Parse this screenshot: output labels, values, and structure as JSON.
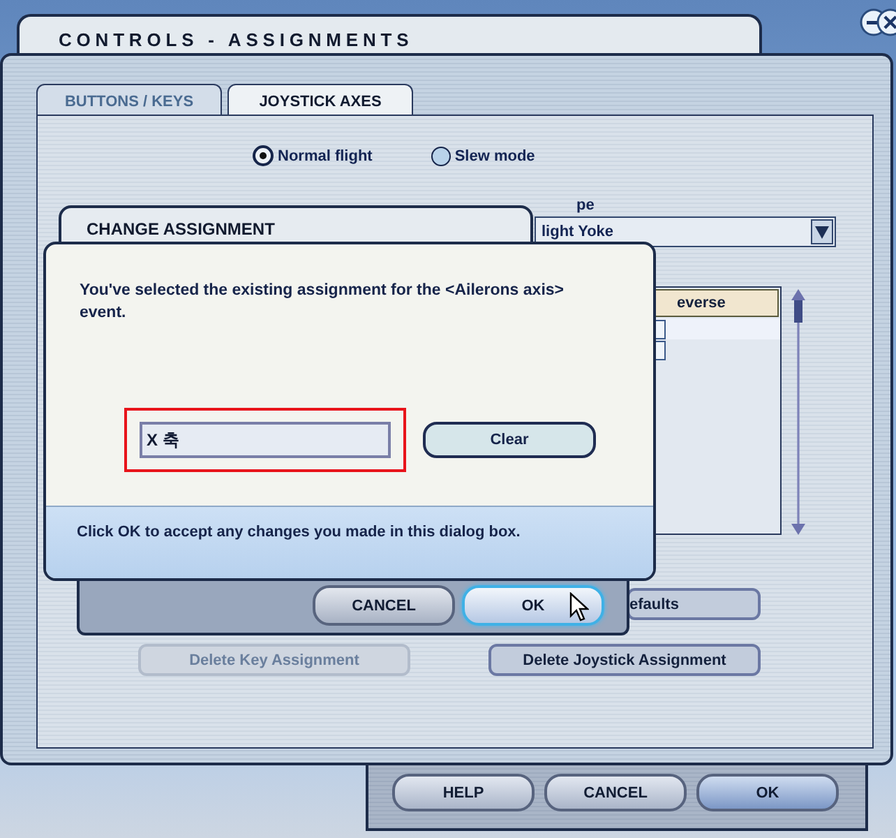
{
  "window": {
    "title": "CONTROLS - ASSIGNMENTS"
  },
  "tabs": [
    {
      "label": "BUTTONS / KEYS",
      "selected": false
    },
    {
      "label": "JOYSTICK AXES",
      "selected": true
    }
  ],
  "mode_options": [
    {
      "label": "Normal flight",
      "selected": true
    },
    {
      "label": "Slew mode",
      "selected": false
    }
  ],
  "joystick_type": {
    "label": "pe",
    "value": "light Yoke"
  },
  "assignment_list": {
    "column_header": "everse"
  },
  "buttons": [
    {
      "label": "efaults",
      "disabled": false
    },
    {
      "label": "Delete Key Assignment",
      "disabled": true
    },
    {
      "label": "Delete Joystick Assignment",
      "disabled": false
    }
  ],
  "footer_buttons": [
    {
      "label": "HELP"
    },
    {
      "label": "CANCEL"
    },
    {
      "label": "OK"
    }
  ],
  "dialog": {
    "title": "CHANGE ASSIGNMENT",
    "message": "You've selected the existing assignment for the <Ailerons axis> event.",
    "field": {
      "value": "X 축",
      "highlighted": true
    },
    "clear_button": "Clear",
    "hint": "Click OK to accept any changes you made in this dialog box.",
    "buttons": [
      {
        "label": "CANCEL",
        "focused": false
      },
      {
        "label": "OK",
        "focused": true
      }
    ]
  }
}
